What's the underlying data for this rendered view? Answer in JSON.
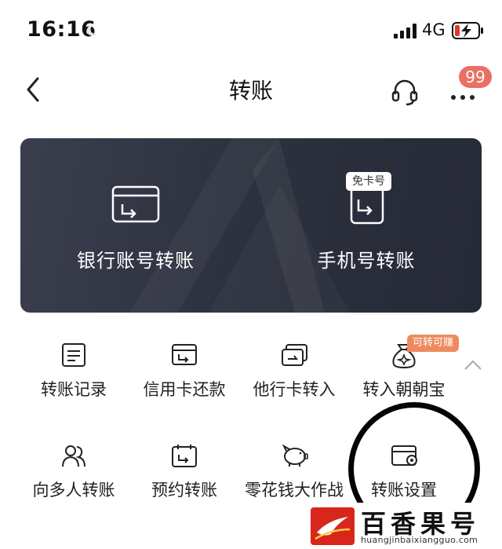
{
  "status_bar": {
    "time": "16:16",
    "network": "4G"
  },
  "nav": {
    "title": "转账",
    "badge": "99"
  },
  "card": {
    "left_label": "银行账号转账",
    "right_label": "手机号转账",
    "right_tag": "免卡号"
  },
  "grid": {
    "row1": [
      "转账记录",
      "信用卡还款",
      "他行卡转入",
      "转入朝朝宝"
    ],
    "row2": [
      "向多人转账",
      "预约转账",
      "零花钱大作战",
      "转账设置"
    ],
    "promo_tag": "可转可赚"
  },
  "watermark": {
    "text": "百香果号",
    "url": "huangjinbaixiangguo.com"
  },
  "icons": {
    "status": [
      "moon-icon",
      "signal-icon",
      "battery-charging-icon"
    ],
    "nav": [
      "back-icon",
      "headset-icon",
      "more-icon"
    ],
    "card": [
      "bank-card-icon",
      "phone-icon"
    ],
    "row1": [
      "record-icon",
      "credit-card-icon",
      "card-transfer-in-icon",
      "money-bag-icon"
    ],
    "row2": [
      "people-icon",
      "calendar-icon",
      "piggy-bank-icon",
      "settings-card-icon"
    ]
  },
  "colors": {
    "card_bg": "#2c303d",
    "badge": "#ea6f64",
    "promo": "#ef8a60",
    "accent_red": "#d9261c"
  }
}
